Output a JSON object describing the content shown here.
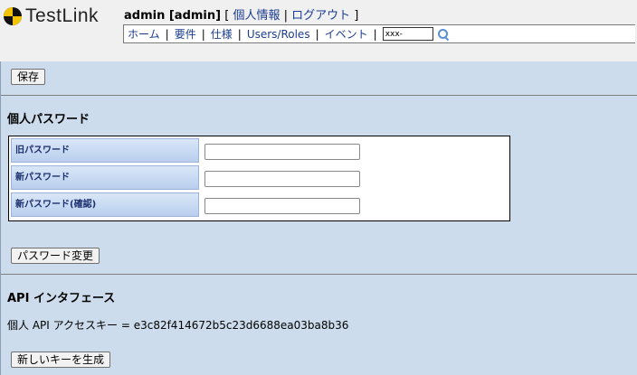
{
  "logo": {
    "text": "TestLink"
  },
  "user": {
    "name": "admin [admin]",
    "open_bracket": "[",
    "personal_info": "個人情報",
    "separator": "|",
    "logout": "ログアウト",
    "close_bracket": "]"
  },
  "nav": {
    "items": [
      "ホーム",
      "要件",
      "仕様",
      "Users/Roles",
      "イベント"
    ],
    "separator": "|",
    "search_value": "xxx-"
  },
  "toolbar": {
    "save_label": "保存"
  },
  "password_section": {
    "title": "個人パスワード",
    "old_label": "旧パスワード",
    "new_label": "新パスワード",
    "confirm_label": "新パスワード(確認)",
    "change_button": "パスワード変更"
  },
  "api_section": {
    "title": "API インタフェース",
    "key_line": "個人 API アクセスキー = e3c82f414672b5c23d6688ea03ba8b36",
    "generate_button": "新しいキーを生成"
  },
  "colors": {
    "content_bg": "#ccdcec",
    "header_bg": "#f0f0f0",
    "link": "#1a3d8f",
    "label_text": "#1a2f6e"
  }
}
